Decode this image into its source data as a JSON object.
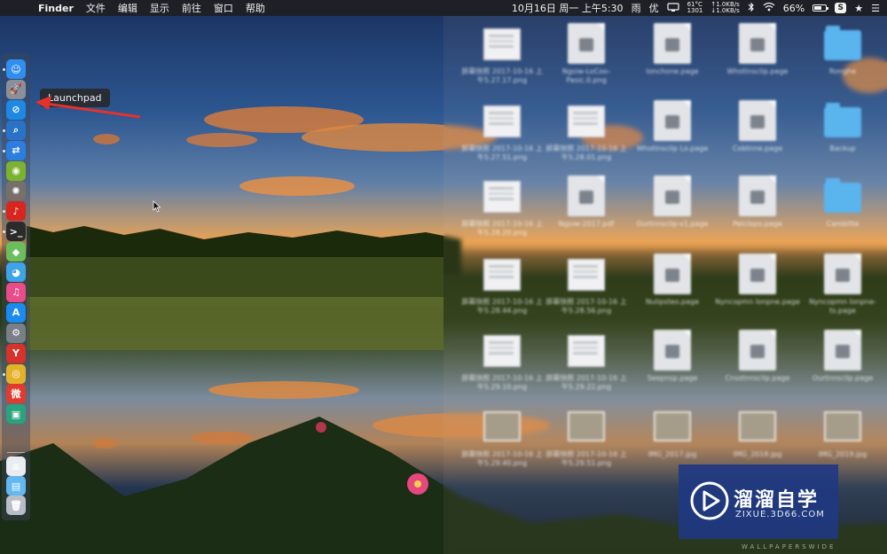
{
  "menubar": {
    "apple_glyph": "",
    "app_name": "Finder",
    "menus": [
      "文件",
      "编辑",
      "显示",
      "前往",
      "窗口",
      "帮助"
    ],
    "datetime": "10月16日 周一 上午5:30",
    "weather": "雨",
    "input_method": "优",
    "cpu_temp": "61°C",
    "fan_rpm": "1301",
    "net_up": "↑1.0KB/s",
    "net_down": "↓1.0KB/s",
    "battery_percent": "66%",
    "battery_level": 0.66,
    "s_badge": "S"
  },
  "tooltip": {
    "label": "Launchpad"
  },
  "dock": {
    "apps": [
      {
        "name": "Finder",
        "color": "#2f8ef0",
        "glyph": "☺"
      },
      {
        "name": "Launchpad",
        "color": "#8a8f99",
        "glyph": "🚀"
      },
      {
        "name": "Safari",
        "color": "#1e88e5",
        "glyph": "⊘"
      },
      {
        "name": "Preview",
        "color": "#2a72c8",
        "glyph": "⌕"
      },
      {
        "name": "TeamViewer",
        "color": "#2b7de0",
        "glyph": "⇄"
      },
      {
        "name": "Android File Transfer",
        "color": "#7bb32e",
        "glyph": "◉"
      },
      {
        "name": "Aperture",
        "color": "#77706a",
        "glyph": "✺"
      },
      {
        "name": "NetEase Music",
        "color": "#d8251d",
        "glyph": "♪"
      },
      {
        "name": "Terminal",
        "color": "#2b2b2b",
        "glyph": ">_"
      },
      {
        "name": "Maps",
        "color": "#6bbe5b",
        "glyph": "◆"
      },
      {
        "name": "QQ",
        "color": "#3fa3e8",
        "glyph": "◕"
      },
      {
        "name": "iTunes",
        "color": "#ea4c89",
        "glyph": "♫"
      },
      {
        "name": "App Store",
        "color": "#1a8cf0",
        "glyph": "A"
      },
      {
        "name": "System Preferences",
        "color": "#7a7f87",
        "glyph": "⚙"
      },
      {
        "name": "Yandex",
        "color": "#d5332c",
        "glyph": "Y"
      },
      {
        "name": "Chrome",
        "color": "#e4b22a",
        "glyph": "◎"
      },
      {
        "name": "Weibo",
        "color": "#e23b2e",
        "glyph": "微"
      },
      {
        "name": "Screen Share",
        "color": "#29a37d",
        "glyph": "▣"
      }
    ],
    "others": [
      {
        "name": "Documents",
        "color": "#e9ecf0",
        "glyph": "≡"
      },
      {
        "name": "Downloads",
        "color": "#63b8ef",
        "glyph": "▤"
      },
      {
        "name": "Trash",
        "color": "#b9bec6",
        "glyph": "🗑"
      }
    ]
  },
  "desktop": {
    "items": [
      {
        "kind": "shot",
        "label": "屏幕快照 2017-10-16 上午5.27.17.png"
      },
      {
        "kind": "file",
        "label": "Ngsiw-LoCoo-Pasic.0.png"
      },
      {
        "kind": "file",
        "label": "Ionchone.page"
      },
      {
        "kind": "file",
        "label": "Whotlnsclip.page"
      },
      {
        "kind": "folder",
        "label": "Ronghe"
      },
      {
        "kind": "shot",
        "label": "屏幕快照 2017-10-16 上午5.27.51.png"
      },
      {
        "kind": "shot",
        "label": "屏幕快照 2017-10-16 上午5.28.01.png"
      },
      {
        "kind": "file",
        "label": "Whotlnsclip Lo.page"
      },
      {
        "kind": "file",
        "label": "Cobtnne.page"
      },
      {
        "kind": "folder",
        "label": "Backup"
      },
      {
        "kind": "shot",
        "label": "屏幕快照 2017-10-16 上午5.28.20.png"
      },
      {
        "kind": "file",
        "label": "Ngsiw-2017.pdf"
      },
      {
        "kind": "file",
        "label": "Ourtnnsclip-v1.page"
      },
      {
        "kind": "file",
        "label": "Pelclopo.page"
      },
      {
        "kind": "folder",
        "label": "Cambitte"
      },
      {
        "kind": "shot",
        "label": "屏幕快照 2017-10-16 上午5.28.44.png"
      },
      {
        "kind": "shot",
        "label": "屏幕快照 2017-10-16 上午5.28.56.png"
      },
      {
        "kind": "file",
        "label": "Nulipsteo.page"
      },
      {
        "kind": "file",
        "label": "Nyncopmn Ionpne.page"
      },
      {
        "kind": "file",
        "label": "Nyncopmn Ionpne-ts.page"
      },
      {
        "kind": "shot",
        "label": "屏幕快照 2017-10-16 上午5.29.10.png"
      },
      {
        "kind": "shot",
        "label": "屏幕快照 2017-10-16 上午5.29.22.png"
      },
      {
        "kind": "file",
        "label": "Seepnsp.page"
      },
      {
        "kind": "file",
        "label": "Cnsstnnsclip.page"
      },
      {
        "kind": "file",
        "label": "Ourtnnsclip.page"
      },
      {
        "kind": "photo",
        "label": "屏幕快照 2017-10-16 上午5.29.40.png"
      },
      {
        "kind": "photo",
        "label": "屏幕快照 2017-10-16 上午5.29.51.png"
      },
      {
        "kind": "photo",
        "label": "IMG_2017.jpg"
      },
      {
        "kind": "photo",
        "label": "IMG_2018.jpg"
      },
      {
        "kind": "photo",
        "label": "IMG_2019.jpg"
      }
    ]
  },
  "watermark": {
    "title": "溜溜自学",
    "site": "ZIXUE.3D66.COM",
    "credit": "WALLPAPERSWIDE"
  }
}
